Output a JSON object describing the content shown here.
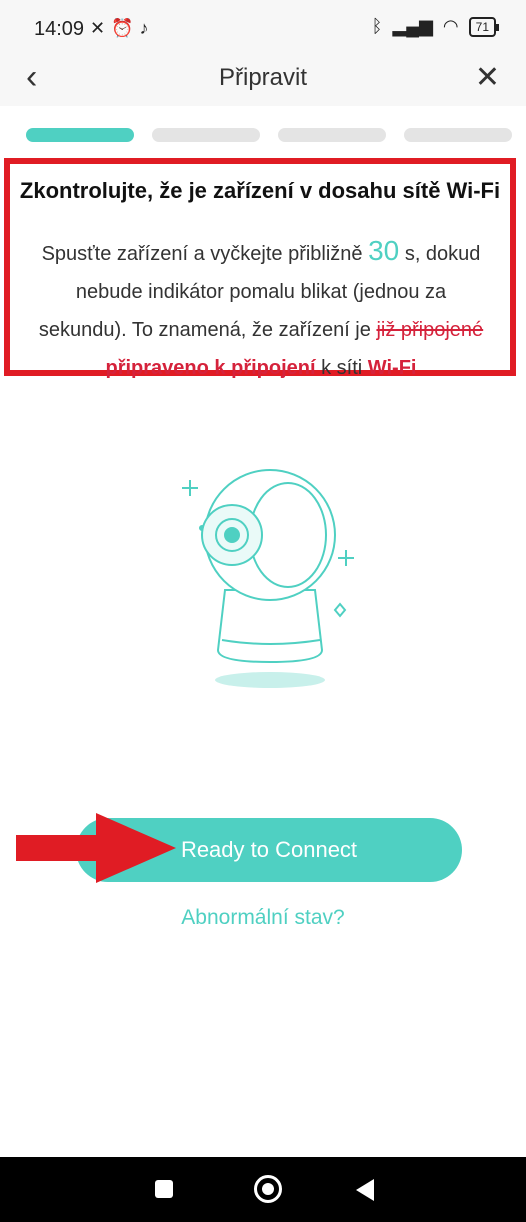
{
  "status_bar": {
    "time": "14:09",
    "battery": "71"
  },
  "header": {
    "title": "Připravit",
    "back_icon": "chevron-left-icon",
    "close_icon": "close-icon"
  },
  "steps": {
    "total": 4,
    "active": 1
  },
  "instruction": {
    "heading": "Zkontrolujte, že je zařízení v dosahu sítě Wi-Fi",
    "text_1": "Spusťte zařízení a vyčkejte přibližně ",
    "seconds": "30",
    "text_2": " s, dokud nebude indikátor pomalu blikat (jednou za sekundu). To znamená, že zařízení je ",
    "struck_text": "již připojené",
    "red_text_1": "připraveno k připojení",
    "text_3": " k síti ",
    "red_text_2": "Wi-Fi"
  },
  "buttons": {
    "connect_label": "Ready to Connect",
    "abnormal_label": "Abnormální stav?"
  },
  "colors": {
    "accent": "#4fd0c2",
    "highlight": "#e01c24"
  }
}
